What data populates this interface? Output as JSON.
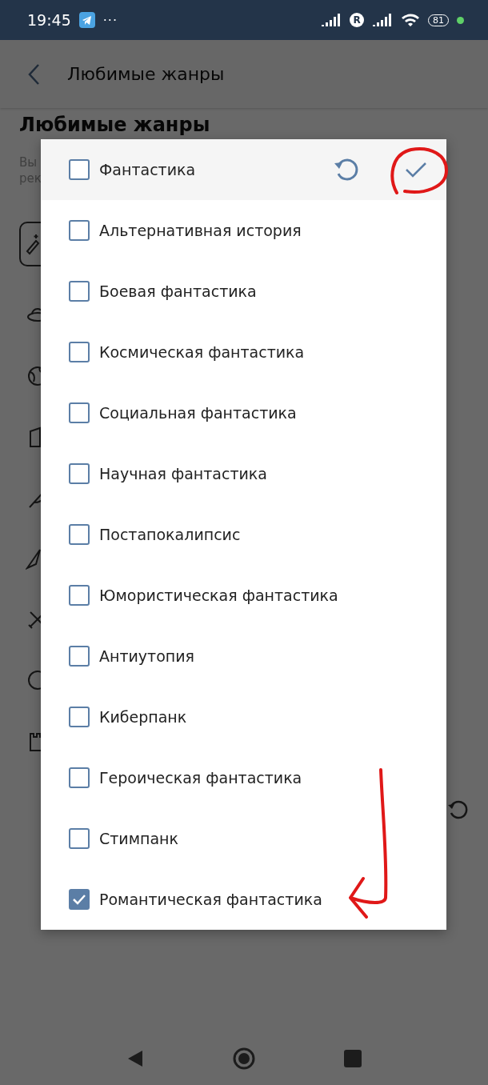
{
  "status_bar": {
    "time": "19:45",
    "more": "···",
    "roaming": "R",
    "battery": "81"
  },
  "app_bar": {
    "title": "Любимые жанры"
  },
  "page": {
    "heading": "Любимые жанры",
    "description_lines": [
      "Вы",
      "рек"
    ]
  },
  "dialog": {
    "items": [
      {
        "label": "Фантастика",
        "checked": false
      },
      {
        "label": "Альтернативная история",
        "checked": false
      },
      {
        "label": "Боевая фантастика",
        "checked": false
      },
      {
        "label": "Космическая фантастика",
        "checked": false
      },
      {
        "label": "Социальная фантастика",
        "checked": false
      },
      {
        "label": "Научная фантастика",
        "checked": false
      },
      {
        "label": "Постапокалипсис",
        "checked": false
      },
      {
        "label": "Юмористическая фантастика",
        "checked": false
      },
      {
        "label": "Антиутопия",
        "checked": false
      },
      {
        "label": "Киберпанк",
        "checked": false
      },
      {
        "label": "Героическая фантастика",
        "checked": false
      },
      {
        "label": "Стимпанк",
        "checked": false
      },
      {
        "label": "Романтическая фантастика",
        "checked": true
      }
    ]
  }
}
